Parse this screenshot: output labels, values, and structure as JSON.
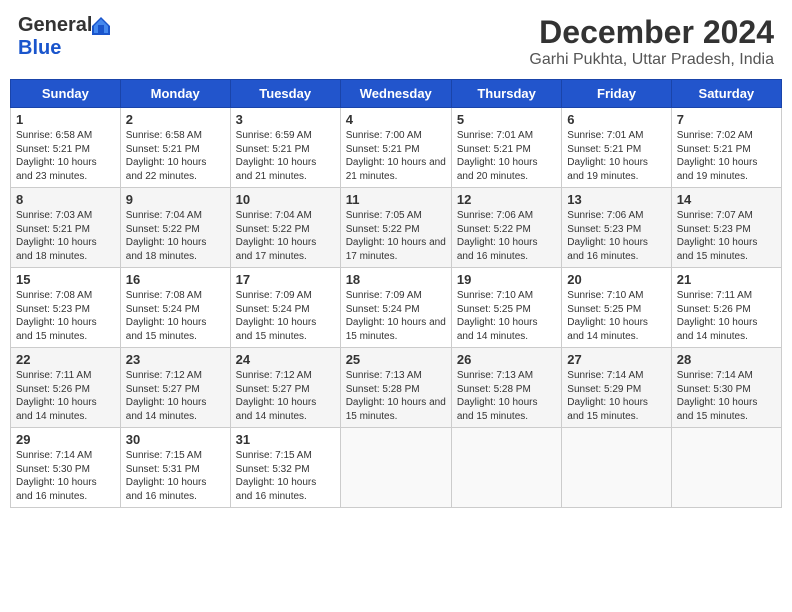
{
  "header": {
    "logo_general": "General",
    "logo_blue": "Blue",
    "title": "December 2024",
    "subtitle": "Garhi Pukhta, Uttar Pradesh, India"
  },
  "weekdays": [
    "Sunday",
    "Monday",
    "Tuesday",
    "Wednesday",
    "Thursday",
    "Friday",
    "Saturday"
  ],
  "weeks": [
    [
      {
        "day": "1",
        "sunrise": "6:58 AM",
        "sunset": "5:21 PM",
        "daylight": "10 hours and 23 minutes."
      },
      {
        "day": "2",
        "sunrise": "6:58 AM",
        "sunset": "5:21 PM",
        "daylight": "10 hours and 22 minutes."
      },
      {
        "day": "3",
        "sunrise": "6:59 AM",
        "sunset": "5:21 PM",
        "daylight": "10 hours and 21 minutes."
      },
      {
        "day": "4",
        "sunrise": "7:00 AM",
        "sunset": "5:21 PM",
        "daylight": "10 hours and 21 minutes."
      },
      {
        "day": "5",
        "sunrise": "7:01 AM",
        "sunset": "5:21 PM",
        "daylight": "10 hours and 20 minutes."
      },
      {
        "day": "6",
        "sunrise": "7:01 AM",
        "sunset": "5:21 PM",
        "daylight": "10 hours and 19 minutes."
      },
      {
        "day": "7",
        "sunrise": "7:02 AM",
        "sunset": "5:21 PM",
        "daylight": "10 hours and 19 minutes."
      }
    ],
    [
      {
        "day": "8",
        "sunrise": "7:03 AM",
        "sunset": "5:21 PM",
        "daylight": "10 hours and 18 minutes."
      },
      {
        "day": "9",
        "sunrise": "7:04 AM",
        "sunset": "5:22 PM",
        "daylight": "10 hours and 18 minutes."
      },
      {
        "day": "10",
        "sunrise": "7:04 AM",
        "sunset": "5:22 PM",
        "daylight": "10 hours and 17 minutes."
      },
      {
        "day": "11",
        "sunrise": "7:05 AM",
        "sunset": "5:22 PM",
        "daylight": "10 hours and 17 minutes."
      },
      {
        "day": "12",
        "sunrise": "7:06 AM",
        "sunset": "5:22 PM",
        "daylight": "10 hours and 16 minutes."
      },
      {
        "day": "13",
        "sunrise": "7:06 AM",
        "sunset": "5:23 PM",
        "daylight": "10 hours and 16 minutes."
      },
      {
        "day": "14",
        "sunrise": "7:07 AM",
        "sunset": "5:23 PM",
        "daylight": "10 hours and 15 minutes."
      }
    ],
    [
      {
        "day": "15",
        "sunrise": "7:08 AM",
        "sunset": "5:23 PM",
        "daylight": "10 hours and 15 minutes."
      },
      {
        "day": "16",
        "sunrise": "7:08 AM",
        "sunset": "5:24 PM",
        "daylight": "10 hours and 15 minutes."
      },
      {
        "day": "17",
        "sunrise": "7:09 AM",
        "sunset": "5:24 PM",
        "daylight": "10 hours and 15 minutes."
      },
      {
        "day": "18",
        "sunrise": "7:09 AM",
        "sunset": "5:24 PM",
        "daylight": "10 hours and 15 minutes."
      },
      {
        "day": "19",
        "sunrise": "7:10 AM",
        "sunset": "5:25 PM",
        "daylight": "10 hours and 14 minutes."
      },
      {
        "day": "20",
        "sunrise": "7:10 AM",
        "sunset": "5:25 PM",
        "daylight": "10 hours and 14 minutes."
      },
      {
        "day": "21",
        "sunrise": "7:11 AM",
        "sunset": "5:26 PM",
        "daylight": "10 hours and 14 minutes."
      }
    ],
    [
      {
        "day": "22",
        "sunrise": "7:11 AM",
        "sunset": "5:26 PM",
        "daylight": "10 hours and 14 minutes."
      },
      {
        "day": "23",
        "sunrise": "7:12 AM",
        "sunset": "5:27 PM",
        "daylight": "10 hours and 14 minutes."
      },
      {
        "day": "24",
        "sunrise": "7:12 AM",
        "sunset": "5:27 PM",
        "daylight": "10 hours and 14 minutes."
      },
      {
        "day": "25",
        "sunrise": "7:13 AM",
        "sunset": "5:28 PM",
        "daylight": "10 hours and 15 minutes."
      },
      {
        "day": "26",
        "sunrise": "7:13 AM",
        "sunset": "5:28 PM",
        "daylight": "10 hours and 15 minutes."
      },
      {
        "day": "27",
        "sunrise": "7:14 AM",
        "sunset": "5:29 PM",
        "daylight": "10 hours and 15 minutes."
      },
      {
        "day": "28",
        "sunrise": "7:14 AM",
        "sunset": "5:30 PM",
        "daylight": "10 hours and 15 minutes."
      }
    ],
    [
      {
        "day": "29",
        "sunrise": "7:14 AM",
        "sunset": "5:30 PM",
        "daylight": "10 hours and 16 minutes."
      },
      {
        "day": "30",
        "sunrise": "7:15 AM",
        "sunset": "5:31 PM",
        "daylight": "10 hours and 16 minutes."
      },
      {
        "day": "31",
        "sunrise": "7:15 AM",
        "sunset": "5:32 PM",
        "daylight": "10 hours and 16 minutes."
      },
      null,
      null,
      null,
      null
    ]
  ]
}
